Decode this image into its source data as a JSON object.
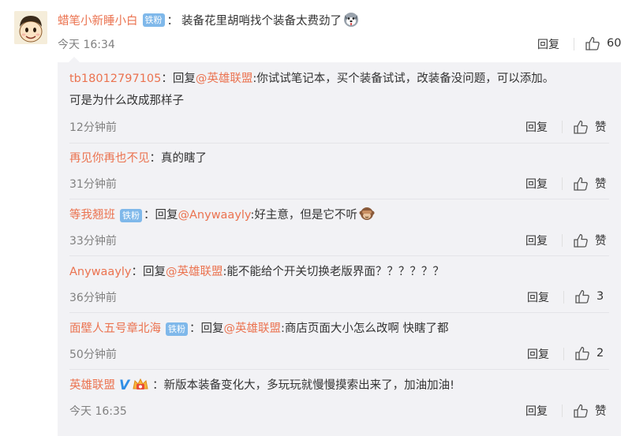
{
  "main_comment": {
    "username": "蜡笔小新睡小白",
    "badge": "铁粉",
    "colon": "：",
    "text": "装备花里胡哨找个装备太费劲了",
    "emoji": "doge-icon",
    "time": "今天 16:34",
    "reply_label": "回复",
    "like_count": "60"
  },
  "replies": [
    {
      "username": "tb18012797105",
      "colon": "：",
      "reply_prefix": "回复",
      "mention": "@英雄联盟",
      "text_line1": ":你试试笔记本，买个装备试试，改装备没问题，可以添加。",
      "text_line2": "可是为什么改成那样子",
      "time": "12分钟前",
      "reply_label": "回复",
      "like_label": "赞"
    },
    {
      "username": "再见你再也不见",
      "colon": "：",
      "text": "真的瞎了",
      "time": "31分钟前",
      "reply_label": "回复",
      "like_label": "赞"
    },
    {
      "username": "等我翘班",
      "badge": "铁粉",
      "colon": "：",
      "reply_prefix": "回复",
      "mention": "@Anywaayly",
      "text": ":好主意，但是它不听",
      "emoji": "see-no-evil-monkey-icon",
      "time": "33分钟前",
      "reply_label": "回复",
      "like_label": "赞"
    },
    {
      "username": "Anywaayly",
      "colon": "：",
      "reply_prefix": "回复",
      "mention": "@英雄联盟",
      "text": ":能不能给个开关切换老版界面？？？？？？",
      "time": "36分钟前",
      "reply_label": "回复",
      "like_label": "3"
    },
    {
      "username": "面壁人五号章北海",
      "badge": "铁粉",
      "colon": "：",
      "reply_prefix": "回复",
      "mention": "@英雄联盟",
      "text": ":商店页面大小怎么改啊 快瞎了都",
      "time": "50分钟前",
      "reply_label": "回复",
      "like_label": "2"
    },
    {
      "username": "英雄联盟",
      "verified": "V",
      "colon": "：",
      "text": "新版本装备变化大，多玩玩就慢慢摸索出来了，加油加油!",
      "time": "今天 16:35",
      "reply_label": "回复",
      "like_label": "赞"
    }
  ],
  "colors": {
    "username": "#eb7350",
    "badge_bg": "#7fb8ea",
    "reply_bg": "#f2f2f5",
    "meta": "#808080",
    "verified": "#2f8ee6"
  }
}
